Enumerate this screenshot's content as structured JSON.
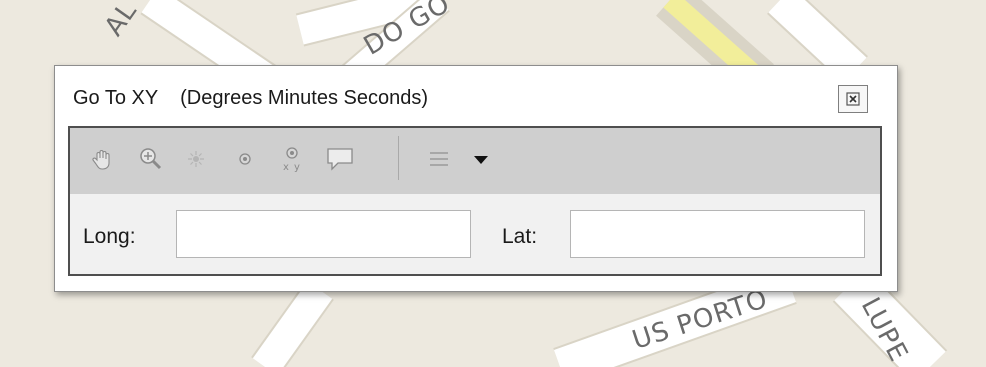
{
  "map": {
    "labels": [
      "AL",
      "DO GO",
      "US PORTO",
      "LUPE"
    ],
    "colors": {
      "background": "#ede9df",
      "road": "#ffffff",
      "road_edge": "#d9d4c6",
      "highway": "#f2ee9a"
    }
  },
  "dialog": {
    "title": "Go To XY",
    "subtitle": "(Degrees Minutes Seconds)",
    "close_icon": "close-icon",
    "toolbar": {
      "tools": [
        "pan-icon",
        "zoom-to-icon",
        "flash-icon",
        "add-point-icon",
        "add-labeled-point-icon",
        "add-callout-icon"
      ],
      "menu_icon": "list-icon",
      "dropdown_icon": "dropdown-arrow-icon"
    },
    "fields": {
      "long_label": "Long:",
      "long_value": "",
      "lat_label": "Lat:",
      "lat_value": ""
    }
  }
}
